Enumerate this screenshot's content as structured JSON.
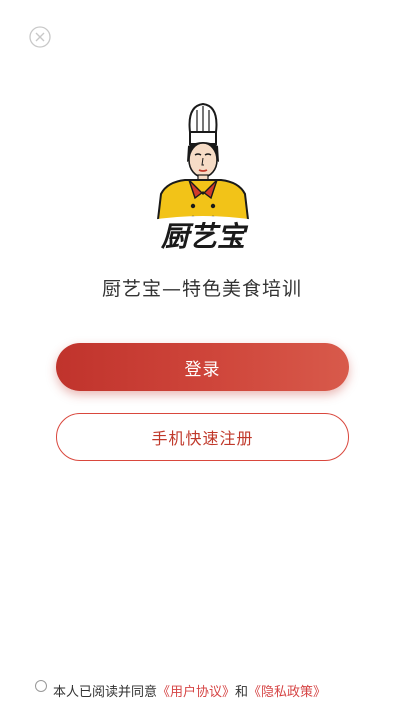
{
  "header": {
    "close_icon": "close-circle-icon"
  },
  "logo": {
    "brand_text": "厨艺宝",
    "colors": {
      "uniform": "#f2c318",
      "scarf": "#d23a2a",
      "outline": "#1a1a1a"
    }
  },
  "app_name": "厨艺宝—特色美食培训",
  "buttons": {
    "login_label": "登录",
    "register_label": "手机快速注册"
  },
  "agreement": {
    "checked": false,
    "prefix": "本人已阅读并同意",
    "user_agreement": "《用户协议》",
    "conjunction": "和",
    "privacy_policy": "《隐私政策》"
  },
  "colors": {
    "accent": "#c9352d",
    "link": "#d64545",
    "text": "#333333"
  }
}
